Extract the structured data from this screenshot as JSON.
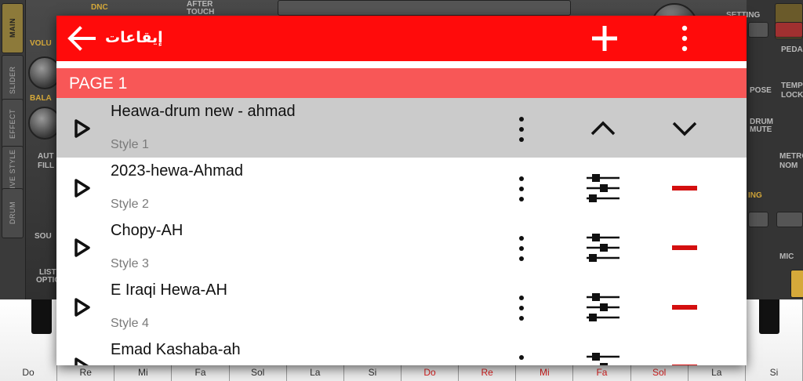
{
  "background": {
    "side_tabs": [
      "MAIN",
      "SLIDER",
      "EFFECT",
      "LIVE STYLE",
      "DRUM"
    ],
    "labels": [
      {
        "text": "DNC",
        "gold": true
      },
      {
        "text": "AFTER",
        "gold": false
      },
      {
        "text": "TOUCH",
        "gold": false
      },
      {
        "text": "SETTING",
        "gold": false
      },
      {
        "text": "VOLU",
        "gold": true
      },
      {
        "text": "BALA",
        "gold": true
      },
      {
        "text": "PEDA",
        "gold": false
      },
      {
        "text": "TEMP",
        "gold": false
      },
      {
        "text": "LOCK",
        "gold": false
      },
      {
        "text": "POSE",
        "gold": false
      },
      {
        "text": "DRUM",
        "gold": false
      },
      {
        "text": "MUTE",
        "gold": false
      },
      {
        "text": "METRO",
        "gold": false
      },
      {
        "text": "NOM",
        "gold": false
      },
      {
        "text": "ING",
        "gold": true
      },
      {
        "text": "MIC",
        "gold": false
      },
      {
        "text": "AUT",
        "gold": false
      },
      {
        "text": "FILL",
        "gold": false
      },
      {
        "text": "SOU",
        "gold": false
      },
      {
        "text": "LIST",
        "gold": false
      },
      {
        "text": "OPTIO",
        "gold": false
      }
    ],
    "keys": [
      {
        "note": "Do",
        "red": false
      },
      {
        "note": "Re",
        "red": false
      },
      {
        "note": "Mi",
        "red": false
      },
      {
        "note": "Fa",
        "red": false
      },
      {
        "note": "Sol",
        "red": false
      },
      {
        "note": "La",
        "red": false
      },
      {
        "note": "Si",
        "red": false
      },
      {
        "note": "Do",
        "red": true
      },
      {
        "note": "Re",
        "red": true
      },
      {
        "note": "Mi",
        "red": true
      },
      {
        "note": "Fa",
        "red": true
      },
      {
        "note": "Sol",
        "red": true
      },
      {
        "note": "La",
        "red": false
      },
      {
        "note": "Si",
        "red": false
      }
    ]
  },
  "dialog": {
    "title": "إيقاعات",
    "back_icon": "arrow-left-icon",
    "add_icon": "plus-icon",
    "overflow_icon": "vertical-dots-icon",
    "colors": {
      "appbar": "#ff0b0b",
      "page_header": "#f85757",
      "selected_row": "#cbcbcb",
      "remove": "#d40f0f"
    },
    "page_header": "PAGE 1",
    "styles": [
      {
        "name": "Heawa-drum new - ahmad",
        "sub": "Style 1",
        "selected": true
      },
      {
        "name": "2023-hewa-Ahmad",
        "sub": "Style 2",
        "selected": false
      },
      {
        "name": "Chopy-AH",
        "sub": "Style 3",
        "selected": false
      },
      {
        "name": "E Iraqi Hewa-AH",
        "sub": "Style 4",
        "selected": false
      },
      {
        "name": "Emad Kashaba-ah",
        "sub": "",
        "selected": false
      }
    ]
  }
}
